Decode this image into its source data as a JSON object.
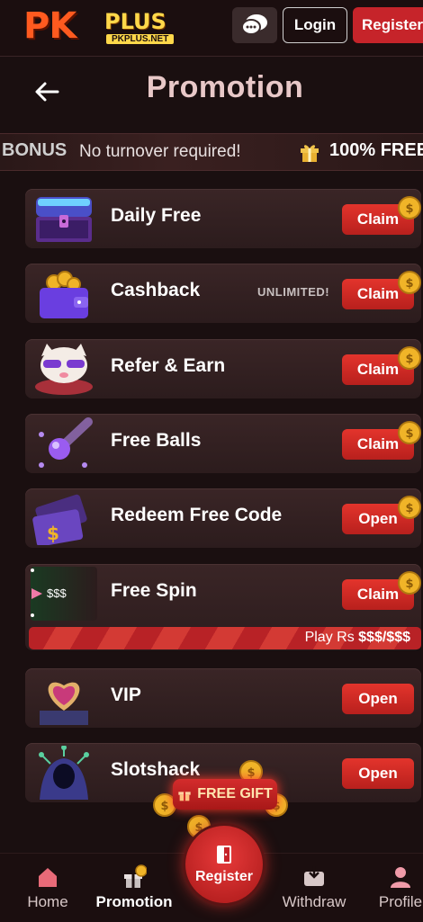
{
  "header": {
    "logo_main": "PK",
    "logo_plus": "PLUS",
    "logo_domain": "PKPLUS.NET",
    "login_label": "Login",
    "register_label": "Register"
  },
  "page": {
    "title": "Promotion"
  },
  "marquee": {
    "bonus_text": "BONUS",
    "message": "No turnover required!",
    "highlight": "100% FREE"
  },
  "promotions": [
    {
      "label": "Daily Free",
      "tag": "",
      "action": "Claim"
    },
    {
      "label": "Cashback",
      "tag": "UNLIMITED!",
      "action": "Claim"
    },
    {
      "label": "Refer & Earn",
      "tag": "",
      "action": "Claim"
    },
    {
      "label": "Free Balls",
      "tag": "",
      "action": "Claim"
    },
    {
      "label": "Redeem Free Code",
      "tag": "",
      "action": "Open"
    },
    {
      "label": "Free Spin",
      "tag": "",
      "action": "Claim",
      "thumb_text": "$$$"
    },
    {
      "label": "VIP",
      "tag": "",
      "action": "Open"
    },
    {
      "label": "Slotshack",
      "tag": "",
      "action": "Open"
    }
  ],
  "free_spin_progress": {
    "prefix": "Play Rs ",
    "value": "$$$/$$$"
  },
  "free_gift": {
    "label": "FREE GIFT"
  },
  "bottom_nav": {
    "home": "Home",
    "promotion": "Promotion",
    "register": "Register",
    "withdraw": "Withdraw",
    "profile": "Profile"
  },
  "colors": {
    "accent": "#c6242a",
    "background": "#1a0f10",
    "coin": "#f0b428"
  }
}
